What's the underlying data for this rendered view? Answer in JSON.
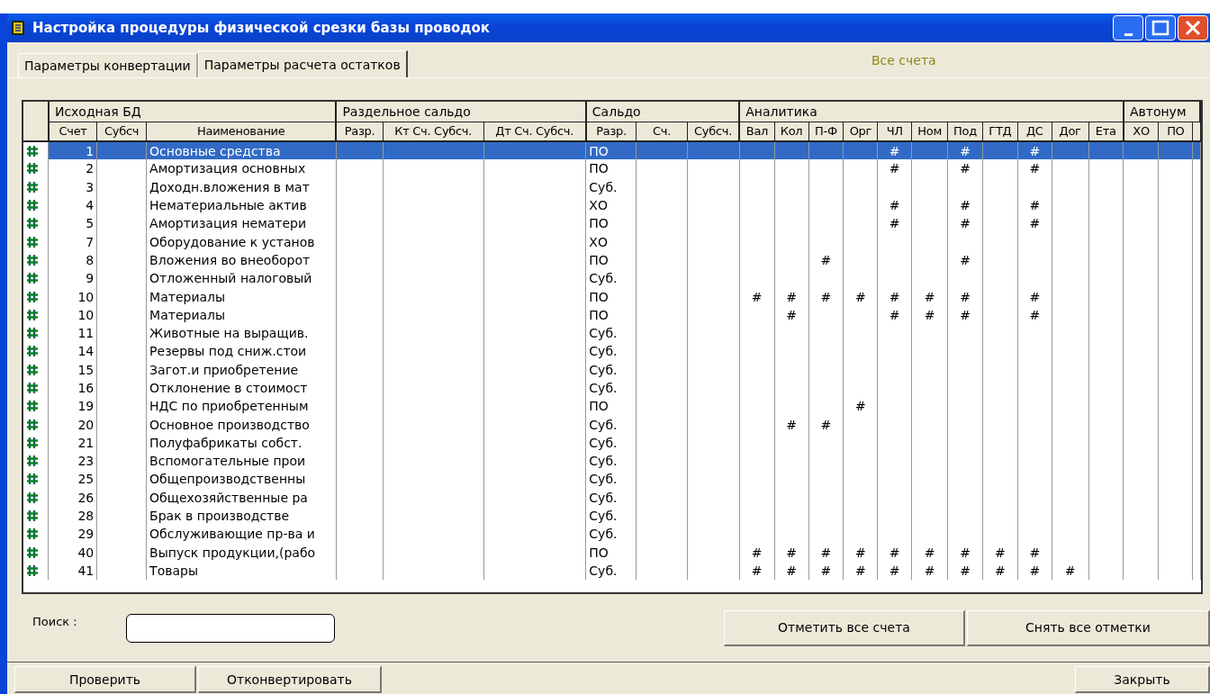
{
  "window": {
    "title": "Настройка процедуры физической срезки базы проводок"
  },
  "tabs": [
    {
      "label": "Параметры конвертации",
      "selected": false
    },
    {
      "label": "Параметры расчета остатков",
      "selected": true
    }
  ],
  "filter_label": "Все счета",
  "table": {
    "groups": [
      {
        "label": "Исходная БД",
        "span": [
          "Счет",
          "Субсч",
          "Наименование"
        ]
      },
      {
        "label": "Раздельное сальдо",
        "span": [
          "Разр.",
          "Кт Сч. Субсч.",
          "Дт Сч. Субсч."
        ]
      },
      {
        "label": "Сальдо",
        "span": [
          "Разр.",
          "Сч.",
          "Субсч."
        ]
      },
      {
        "label": "Аналитика",
        "span": [
          "Вал",
          "Кол",
          "П-Ф",
          "Орг",
          "ЧЛ",
          "Ном",
          "Под",
          "ГТД",
          "ДС",
          "Дог",
          "Ета"
        ]
      },
      {
        "label": "Автонум",
        "span": [
          "ХО",
          "ПО"
        ]
      }
    ],
    "rows": [
      {
        "account": "1",
        "name": "Основные средства",
        "saldo": "ПО",
        "selected": true,
        "analytics": {
          "chl": "#",
          "pod": "#",
          "ds": "#"
        }
      },
      {
        "account": "2",
        "name": "Амортизация основных",
        "saldo": "ПО",
        "selected": false,
        "analytics": {
          "chl": "#",
          "pod": "#",
          "ds": "#"
        }
      },
      {
        "account": "3",
        "name": "Доходн.вложения в мат",
        "saldo": "Суб.",
        "selected": false
      },
      {
        "account": "4",
        "name": "Нематериальные актив",
        "saldo": "ХО",
        "selected": false,
        "analytics": {
          "chl": "#",
          "pod": "#",
          "ds": "#"
        }
      },
      {
        "account": "5",
        "name": "Амортизация нематери",
        "saldo": "ПО",
        "selected": false,
        "analytics": {
          "chl": "#",
          "pod": "#",
          "ds": "#"
        }
      },
      {
        "account": "7",
        "name": "Оборудование к установ",
        "saldo": "ХО",
        "selected": false
      },
      {
        "account": "8",
        "name": "Вложения во внеоборот",
        "saldo": "ПО",
        "selected": false,
        "analytics": {
          "pf": "#",
          "pod": "#"
        }
      },
      {
        "account": "9",
        "name": "Отложенный налоговый",
        "saldo": "Суб.",
        "selected": false
      },
      {
        "account": "10",
        "name": "Материалы",
        "saldo": "ПО",
        "selected": false,
        "analytics": {
          "val": "#",
          "kol": "#",
          "pf": "#",
          "org": "#",
          "chl": "#",
          "nom": "#",
          "pod": "#",
          "ds": "#"
        }
      },
      {
        "account": "10",
        "name": "Материалы",
        "saldo": "ПО",
        "selected": false,
        "analytics": {
          "kol": "#",
          "chl": "#",
          "nom": "#",
          "pod": "#",
          "ds": "#"
        }
      },
      {
        "account": "11",
        "name": "Животные на выращив.",
        "saldo": "Суб.",
        "selected": false
      },
      {
        "account": "14",
        "name": "Резервы под сниж.стои",
        "saldo": "Суб.",
        "selected": false
      },
      {
        "account": "15",
        "name": "Загот.и приобретение",
        "saldo": "Суб.",
        "selected": false
      },
      {
        "account": "16",
        "name": "Отклонение в стоимост",
        "saldo": "Суб.",
        "selected": false
      },
      {
        "account": "19",
        "name": "НДС по приобретенным",
        "saldo": "ПО",
        "selected": false,
        "analytics": {
          "org": "#"
        }
      },
      {
        "account": "20",
        "name": "Основное производство",
        "saldo": "Суб.",
        "selected": false,
        "analytics": {
          "kol": "#",
          "pf": "#"
        }
      },
      {
        "account": "21",
        "name": "Полуфабрикаты собст.",
        "saldo": "Суб.",
        "selected": false
      },
      {
        "account": "23",
        "name": "Вспомогательные прои",
        "saldo": "Суб.",
        "selected": false
      },
      {
        "account": "25",
        "name": "Общепроизводственны",
        "saldo": "Суб.",
        "selected": false
      },
      {
        "account": "26",
        "name": "Общехозяйственные ра",
        "saldo": "Суб.",
        "selected": false
      },
      {
        "account": "28",
        "name": "Брак в производстве",
        "saldo": "Суб.",
        "selected": false
      },
      {
        "account": "29",
        "name": "Обслуживающие пр-ва и",
        "saldo": "Суб.",
        "selected": false
      },
      {
        "account": "40",
        "name": "Выпуск продукции,(рабо",
        "saldo": "ПО",
        "selected": false,
        "analytics": {
          "val": "#",
          "kol": "#",
          "pf": "#",
          "org": "#",
          "chl": "#",
          "nom": "#",
          "pod": "#",
          "gtd": "#",
          "ds": "#"
        }
      },
      {
        "account": "41",
        "name": "Товары",
        "saldo": "Суб.",
        "selected": false,
        "analytics": {
          "val": "#",
          "kol": "#",
          "pf": "#",
          "org": "#",
          "chl": "#",
          "nom": "#",
          "pod": "#",
          "gtd": "#",
          "ds": "#",
          "dog": "#"
        }
      }
    ]
  },
  "search": {
    "label": "Поиск :"
  },
  "mark_buttons": [
    "Отметить все счета",
    "Снять все отметки"
  ],
  "footer_buttons": {
    "left": [
      "Проверить",
      "Отконвертировать"
    ],
    "right": [
      "Закрыть"
    ]
  }
}
